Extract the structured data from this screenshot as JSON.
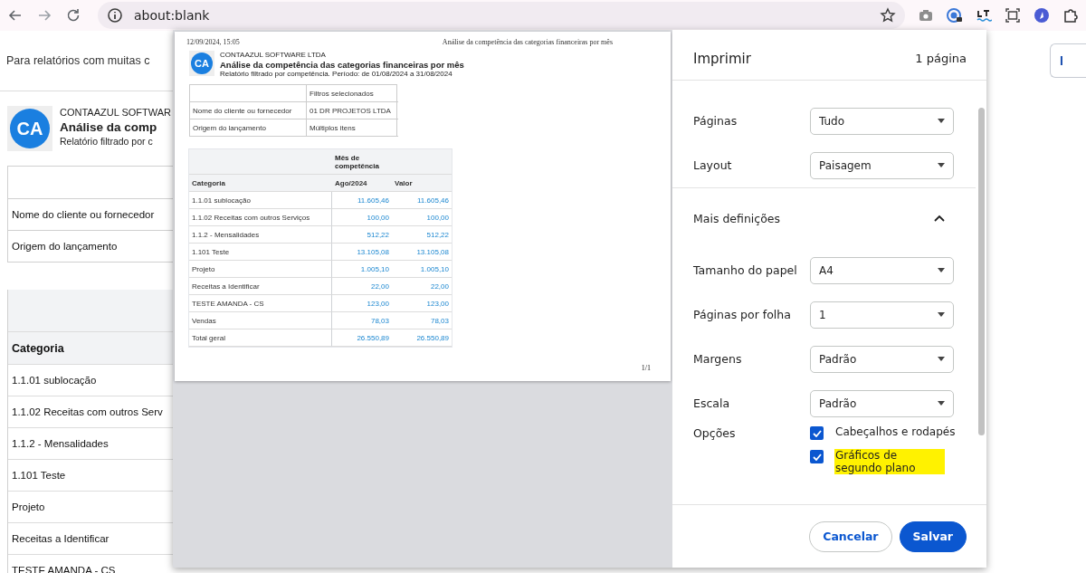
{
  "browser": {
    "url": "about:blank",
    "bookmarked": false
  },
  "page": {
    "notice": "Para relatórios com muitas c",
    "logo": "CA",
    "company": "CONTAAZUL SOFTWAR",
    "title": "Análise da comp",
    "subtitle": "Relatório filtrado por c",
    "filter_rows": [
      "Nome do cliente ou fornecedor",
      "Origem do lançamento"
    ],
    "table_header": "Categoria",
    "rows": [
      "1.1.01 sublocação",
      "1.1.02 Receitas com outros Serv",
      "1.1.2 - Mensalidades",
      "1.101 Teste",
      "Projeto",
      "Receitas a Identificar",
      "TESTE AMANDA - CS"
    ],
    "side_button": "I"
  },
  "print_dialog": {
    "title": "Imprimir",
    "page_count": "1 página",
    "preview": {
      "timestamp": "12/09/2024, 15:05",
      "header_title": "Análise da competência das categorias financeiras por mês",
      "logo": "CA",
      "company": "CONTAAZUL SOFTWARE LTDA",
      "title": "Análise da competência das categorias financeiras por mês",
      "subtitle": "Relatório filtrado por competência. Período: de 01/08/2024 a 31/08/2024",
      "filters": {
        "heading": "Filtros selecionados",
        "rows": [
          {
            "label": "Nome do cliente ou fornecedor",
            "value": "01 DR PROJETOS LTDA"
          },
          {
            "label": "Origem do lançamento",
            "value": "Múltiplos itens"
          }
        ]
      },
      "table": {
        "group_header": "Mês de competência",
        "columns": [
          "Categoria",
          "Ago/2024",
          "Valor"
        ],
        "rows": [
          {
            "category": "1.1.01 sublocação",
            "month": "11.605,46",
            "total": "11.605,46"
          },
          {
            "category": "1.1.02 Receitas com outros Serviços",
            "month": "100,00",
            "total": "100,00"
          },
          {
            "category": "1.1.2 - Mensalidades",
            "month": "512,22",
            "total": "512,22"
          },
          {
            "category": "1.101 Teste",
            "month": "13.105,08",
            "total": "13.105,08"
          },
          {
            "category": "Projeto",
            "month": "1.005,10",
            "total": "1.005,10"
          },
          {
            "category": "Receitas a Identificar",
            "month": "22,00",
            "total": "22,00"
          },
          {
            "category": "TESTE AMANDA - CS",
            "month": "123,00",
            "total": "123,00"
          },
          {
            "category": "Vendas",
            "month": "78,03",
            "total": "78,03"
          },
          {
            "category": "Total geral",
            "month": "26.550,89",
            "total": "26.550,89"
          }
        ]
      },
      "page_number": "1/1"
    },
    "settings": [
      {
        "kind": "select",
        "label": "Páginas",
        "value": "Tudo"
      },
      {
        "kind": "select",
        "label": "Layout",
        "value": "Paisagem"
      },
      {
        "kind": "section",
        "label": "Mais definições",
        "expanded": true
      },
      {
        "kind": "select",
        "label": "Tamanho do papel",
        "value": "A4"
      },
      {
        "kind": "select",
        "label": "Páginas por folha",
        "value": "1"
      },
      {
        "kind": "select",
        "label": "Margens",
        "value": "Padrão"
      },
      {
        "kind": "select",
        "label": "Escala",
        "value": "Padrão"
      },
      {
        "kind": "checkboxes",
        "label": "Opções",
        "options": [
          {
            "label": "Cabeçalhos e rodapés",
            "checked": true,
            "highlighted": false
          },
          {
            "label": "Gráficos de segundo plano",
            "checked": true,
            "highlighted": true
          }
        ]
      }
    ],
    "buttons": [
      {
        "label": "Cancelar",
        "kind": "secondary"
      },
      {
        "label": "Salvar",
        "kind": "primary"
      }
    ]
  }
}
